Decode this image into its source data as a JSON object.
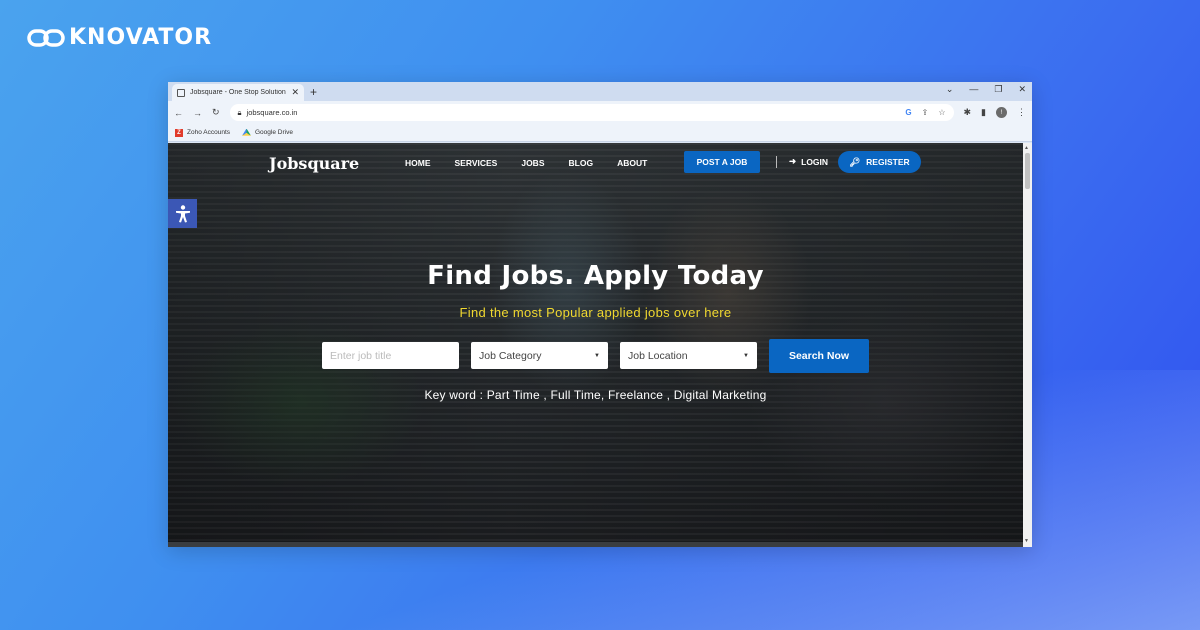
{
  "brand": {
    "name": "KNOVATOR",
    "icon": "infinity-link-icon"
  },
  "browser": {
    "tab": {
      "title": "Jobsquare - One Stop Solution fo",
      "favicon": "page-icon",
      "close": "✕"
    },
    "new_tab": "+",
    "window_controls": {
      "dropdown": "⌄",
      "minimize": "—",
      "maximize": "❐",
      "close": "✕"
    },
    "nav": {
      "back": "←",
      "forward": "→",
      "reload": "↻"
    },
    "address": {
      "url": "jobsquare.co.in",
      "lock": "lock-icon"
    },
    "omnibox_icons": {
      "google": "G",
      "share": "⇪",
      "star": "☆"
    },
    "extensions": {
      "puzzle": "✱",
      "sidepanel": "▮",
      "avatar_initial": "!",
      "menu": "⋮"
    },
    "bookmarks": [
      {
        "label": "Zoho Accounts",
        "icon": "Z"
      },
      {
        "label": "Google Drive",
        "icon": "drive"
      }
    ]
  },
  "site": {
    "logo": "Jobsquare",
    "nav_links": [
      "HOME",
      "SERVICES",
      "JOBS",
      "BLOG",
      "ABOUT"
    ],
    "post_job": "POST A JOB",
    "login": "LOGIN",
    "register": "REGISTER",
    "hero": {
      "title": "Find Jobs. Apply Today",
      "subtitle": "Find the most Popular applied jobs over here"
    },
    "search": {
      "title_placeholder": "Enter job title",
      "category": "Job Category",
      "location": "Job Location",
      "button": "Search Now"
    },
    "keywords": "Key word : Part Time , Full Time, Freelance , Digital Marketing",
    "colors": {
      "primary": "#0a66c2",
      "subtitle": "#f0d830",
      "accessibility": "#3b57b5"
    }
  }
}
